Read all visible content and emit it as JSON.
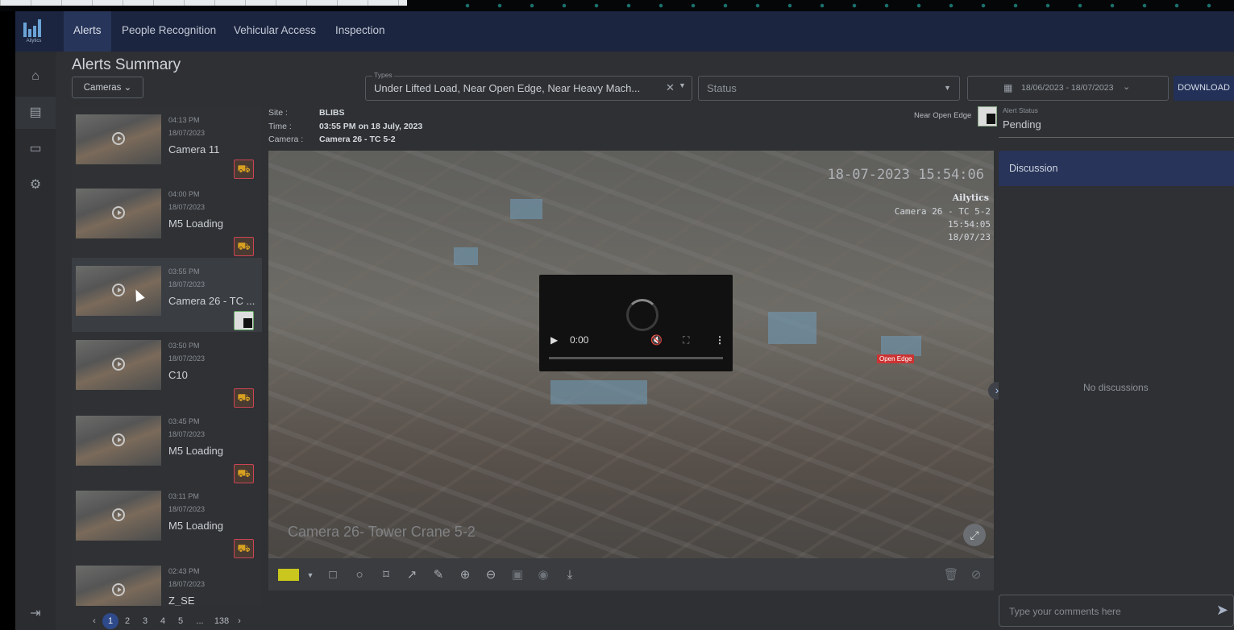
{
  "app": {
    "brand": "Ailytics"
  },
  "nav": {
    "tabs": [
      {
        "label": "Alerts"
      },
      {
        "label": "People Recognition"
      },
      {
        "label": "Vehicular Access"
      },
      {
        "label": "Inspection"
      }
    ]
  },
  "sidebar": {
    "icons": [
      "home-icon",
      "list-icon",
      "chat-icon",
      "settings-icon"
    ],
    "logout_icon": "logout-icon"
  },
  "page": {
    "title": "Alerts Summary"
  },
  "filters": {
    "cameras_label": "Cameras",
    "types_label": "Types",
    "types_value": "Under Lifted Load, Near Open Edge, Near Heavy Mach...",
    "status_placeholder": "Status",
    "date_range": "18/06/2023 - 18/07/2023",
    "download_label": "DOWNLOAD"
  },
  "alert_list": [
    {
      "time": "04:13 PM",
      "date": "18/07/2023",
      "camera": "Camera 11",
      "badge": "heavy-machinery-icon"
    },
    {
      "time": "04:00 PM",
      "date": "18/07/2023",
      "camera": "M5 Loading",
      "badge": "heavy-machinery-icon"
    },
    {
      "time": "03:55 PM",
      "date": "18/07/2023",
      "camera": "Camera 26 - TC ...",
      "badge": "open-edge-icon",
      "selected": true
    },
    {
      "time": "03:50 PM",
      "date": "18/07/2023",
      "camera": "C10",
      "badge": "heavy-machinery-icon"
    },
    {
      "time": "03:45 PM",
      "date": "18/07/2023",
      "camera": "M5 Loading",
      "badge": "heavy-machinery-icon"
    },
    {
      "time": "03:11 PM",
      "date": "18/07/2023",
      "camera": "M5 Loading",
      "badge": "heavy-machinery-icon"
    },
    {
      "time": "02:43 PM",
      "date": "18/07/2023",
      "camera": "Z_SE"
    }
  ],
  "pagination": {
    "prev": "‹",
    "pages": [
      "1",
      "2",
      "3",
      "4",
      "5"
    ],
    "ellipsis": "...",
    "last": "138",
    "next": "›",
    "current": "1"
  },
  "detail": {
    "site_label": "Site :",
    "site_value": "BLIBS",
    "time_label": "Time :",
    "time_value": "03:55 PM on 18 July, 2023",
    "camera_label": "Camera :",
    "camera_value": "Camera 26 - TC 5-2",
    "alert_type": "Near Open Edge",
    "alert_status_label": "Alert Status",
    "alert_status_value": "Pending"
  },
  "video": {
    "timestamp": "18-07-2023 15:54:06",
    "brand_overlay": "Ailytics",
    "overlay_camera": "Camera 26 - TC 5-2",
    "overlay_time": "15:54:05",
    "overlay_date": "18/07/23",
    "camera_caption": "Camera 26- Tower Crane 5-2",
    "open_edge_tag": "Open Edge",
    "player_time": "0:00"
  },
  "toolbar": {
    "color": "#c9c61e",
    "tools": [
      "square-icon",
      "circle-icon",
      "polygon-icon",
      "arrow-icon",
      "edit-icon",
      "zoom-in-icon",
      "zoom-out-icon",
      "save-icon",
      "eye-icon",
      "download-icon"
    ],
    "right_tools": [
      "trash-icon",
      "block-icon"
    ]
  },
  "discussion": {
    "title": "Discussion",
    "empty_text": "No discussions",
    "comment_placeholder": "Type your comments here"
  }
}
